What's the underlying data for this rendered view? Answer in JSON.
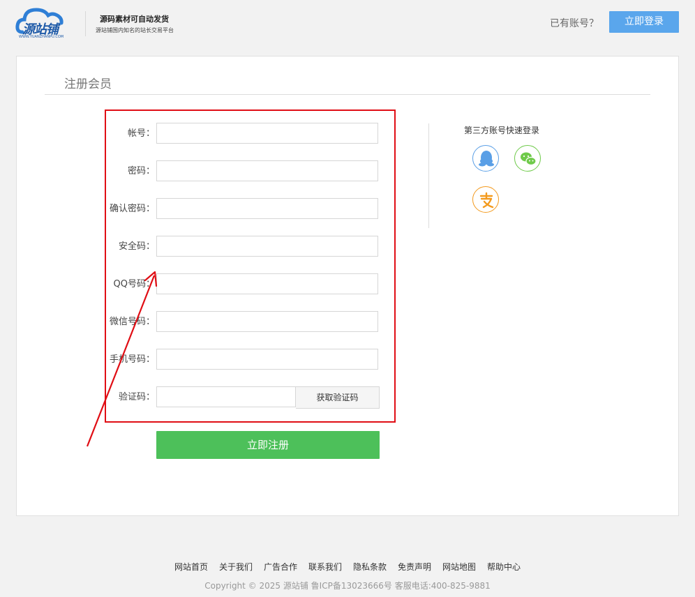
{
  "header": {
    "logo_text": "源站铺",
    "logo_sub": "WWW.YUANZHANPU.COM",
    "slogan_main": "源码素材可自动发货",
    "slogan_sub": "源站铺国内知名的站长交易平台",
    "has_account": "已有账号？",
    "login_label": "立即登录",
    "brand_color": "#5aa6ec"
  },
  "register": {
    "title": "注册会员",
    "fields": [
      {
        "label": "帐号：",
        "value": "",
        "placeholder": ""
      },
      {
        "label": "密码：",
        "value": "",
        "placeholder": ""
      },
      {
        "label": "确认密码：",
        "value": "",
        "placeholder": ""
      },
      {
        "label": "安全码：",
        "value": "",
        "placeholder": ""
      },
      {
        "label": "QQ号码：",
        "value": "",
        "placeholder": ""
      },
      {
        "label": "微信号码：",
        "value": "",
        "placeholder": ""
      },
      {
        "label": "手机号码：",
        "value": "",
        "placeholder": ""
      }
    ],
    "captcha": {
      "label": "验证码：",
      "value": "",
      "button_label": "获取验证码"
    },
    "submit_label": "立即注册",
    "submit_color": "#4dc05a"
  },
  "third_party": {
    "title": "第三方账号快速登录",
    "providers": [
      {
        "name": "qq",
        "icon": "qq-icon",
        "color": "#5a9fe6"
      },
      {
        "name": "wechat",
        "icon": "wechat-icon",
        "color": "#6fca4a"
      },
      {
        "name": "alipay",
        "icon": "alipay-icon",
        "color": "#f39a1e"
      }
    ]
  },
  "annotation": {
    "box_color": "#e00d14"
  },
  "footer": {
    "links": [
      "网站首页",
      "关于我们",
      "广告合作",
      "联系我们",
      "隐私条款",
      "免责声明",
      "网站地图",
      "帮助中心"
    ],
    "copyright": "Copyright © 2025 源站铺 鲁ICP备13023666号 客服电话:400-825-9881"
  }
}
